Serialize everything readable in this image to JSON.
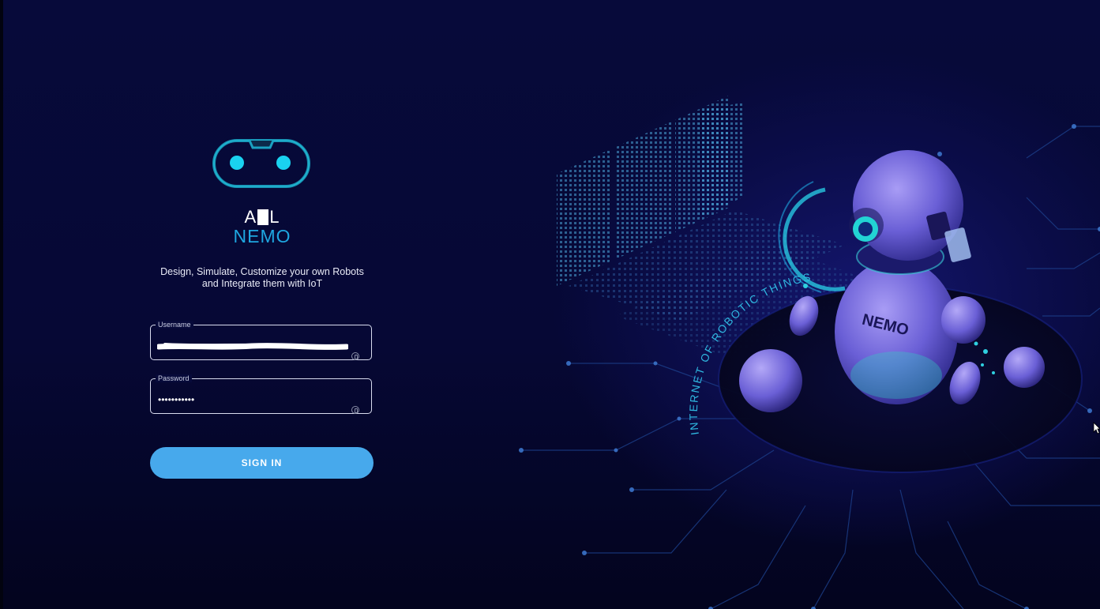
{
  "brand": {
    "top_prefix": "A",
    "top_suffix": "L",
    "name": "NEMO"
  },
  "tagline": {
    "line1": "Design, Simulate, Customize your own Robots",
    "line2": "and Integrate them with IoT"
  },
  "form": {
    "username_label": "Username",
    "password_label": "Password",
    "password_value": "•••••••••••",
    "sign_in_label": "SIGN IN"
  },
  "illustration": {
    "robot_label": "NEMO",
    "arc_text": "INTERNET OF ROBOTIC THINGS",
    "big_letters": "nemo"
  },
  "colors": {
    "background": "#060835",
    "accent": "#1ea6e0",
    "button": "#47a9ec",
    "robot": "#7a6fe0"
  },
  "icons": [
    "robot-face-logo-icon",
    "eye-icon",
    "cursor-icon"
  ]
}
